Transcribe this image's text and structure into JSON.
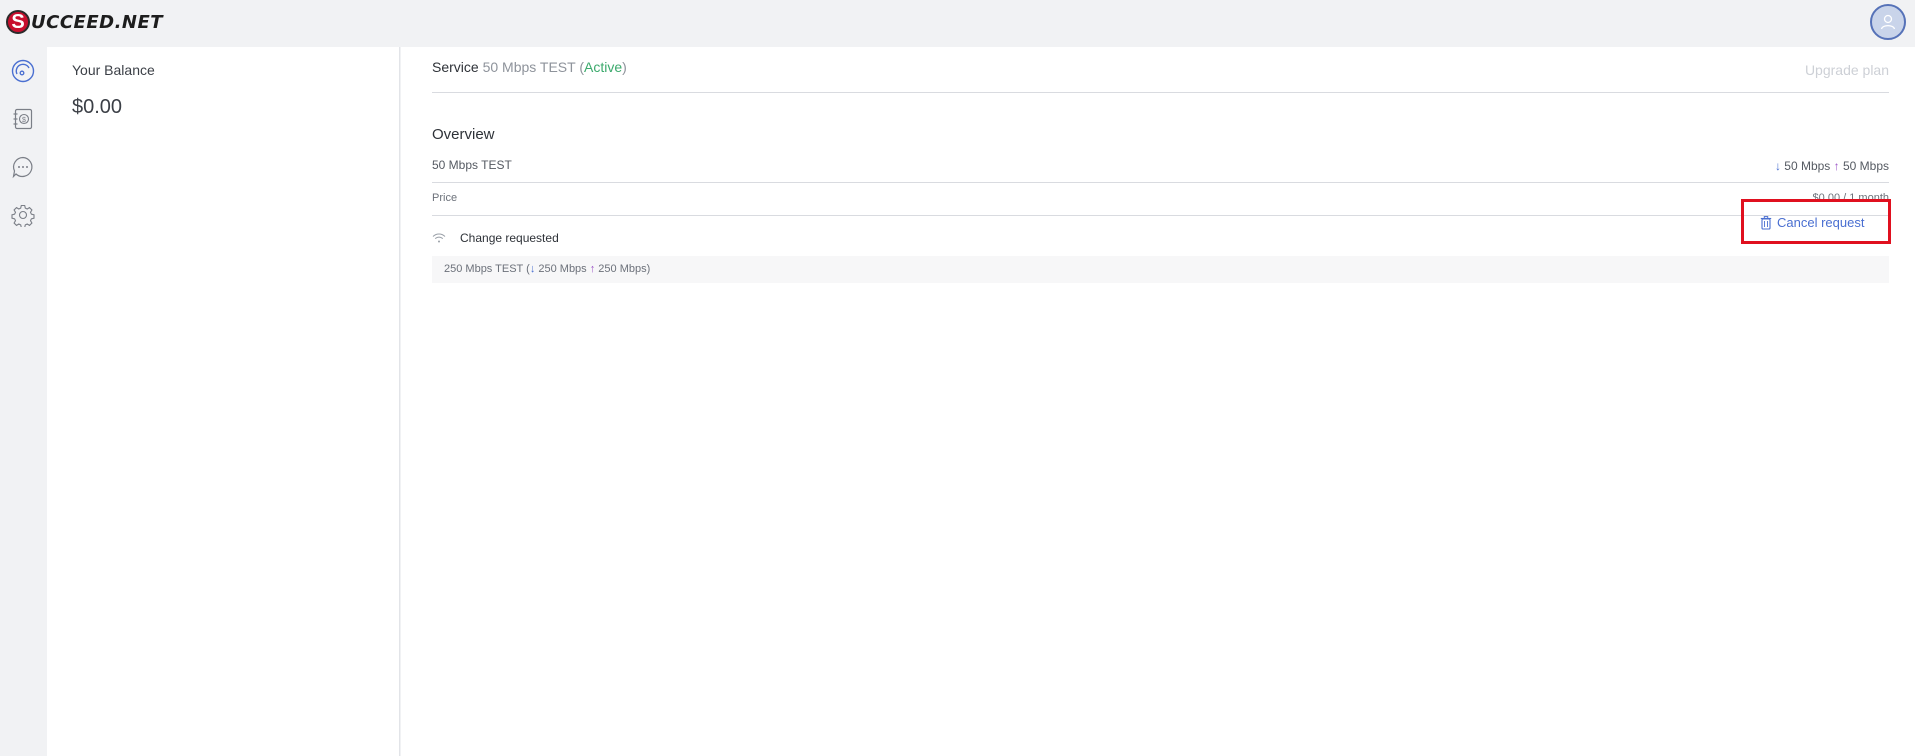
{
  "brand": {
    "logo_initial": "S",
    "logo_rest": "UCCEED.NET"
  },
  "nav": {
    "items": [
      {
        "name": "dashboard",
        "icon": "speedometer-icon"
      },
      {
        "name": "billing",
        "icon": "invoice-dollar-icon"
      },
      {
        "name": "messages",
        "icon": "chat-bubble-icon"
      },
      {
        "name": "settings",
        "icon": "gear-icon"
      }
    ]
  },
  "balance": {
    "title": "Your Balance",
    "amount": "$0.00"
  },
  "service": {
    "label": "Service",
    "name": "50 Mbps TEST",
    "paren_open": " (",
    "status": "Active",
    "paren_close": ")",
    "upgrade_label": "Upgrade plan"
  },
  "overview": {
    "title": "Overview",
    "plan_name": "50 Mbps TEST",
    "down_arrow": "↓",
    "download": " 50 Mbps ",
    "up_arrow": "↑",
    "upload": " 50 Mbps",
    "price_label": "Price",
    "price_value": "$0.00 / 1 month"
  },
  "change_request": {
    "title": "Change requested",
    "plan_prefix": "250 Mbps TEST (",
    "down_arrow": "↓",
    "download": " 250 Mbps ",
    "up_arrow": "↑",
    "upload": " 250 Mbps)",
    "cancel_label": "Cancel request"
  },
  "colors": {
    "accent": "#4a6fd1",
    "active": "#3caa6d",
    "highlight_border": "#e0101f",
    "brand_red": "#c8102e"
  }
}
